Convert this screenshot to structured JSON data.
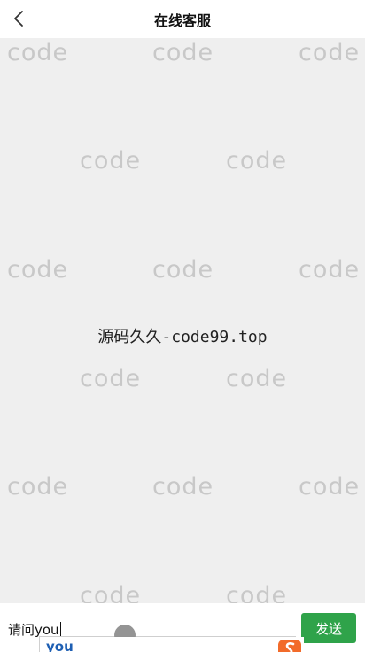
{
  "header": {
    "title": "在线客服",
    "back_icon": "chevron-left-icon"
  },
  "content": {
    "watermark_text": "code",
    "center_text": "源码久久-code99.top"
  },
  "input_bar": {
    "value": "请问you",
    "send_label": "发送",
    "send_color": "#2fa34a"
  },
  "ime": {
    "suggestion": "you",
    "logo_icon": "sogou-s-icon"
  }
}
